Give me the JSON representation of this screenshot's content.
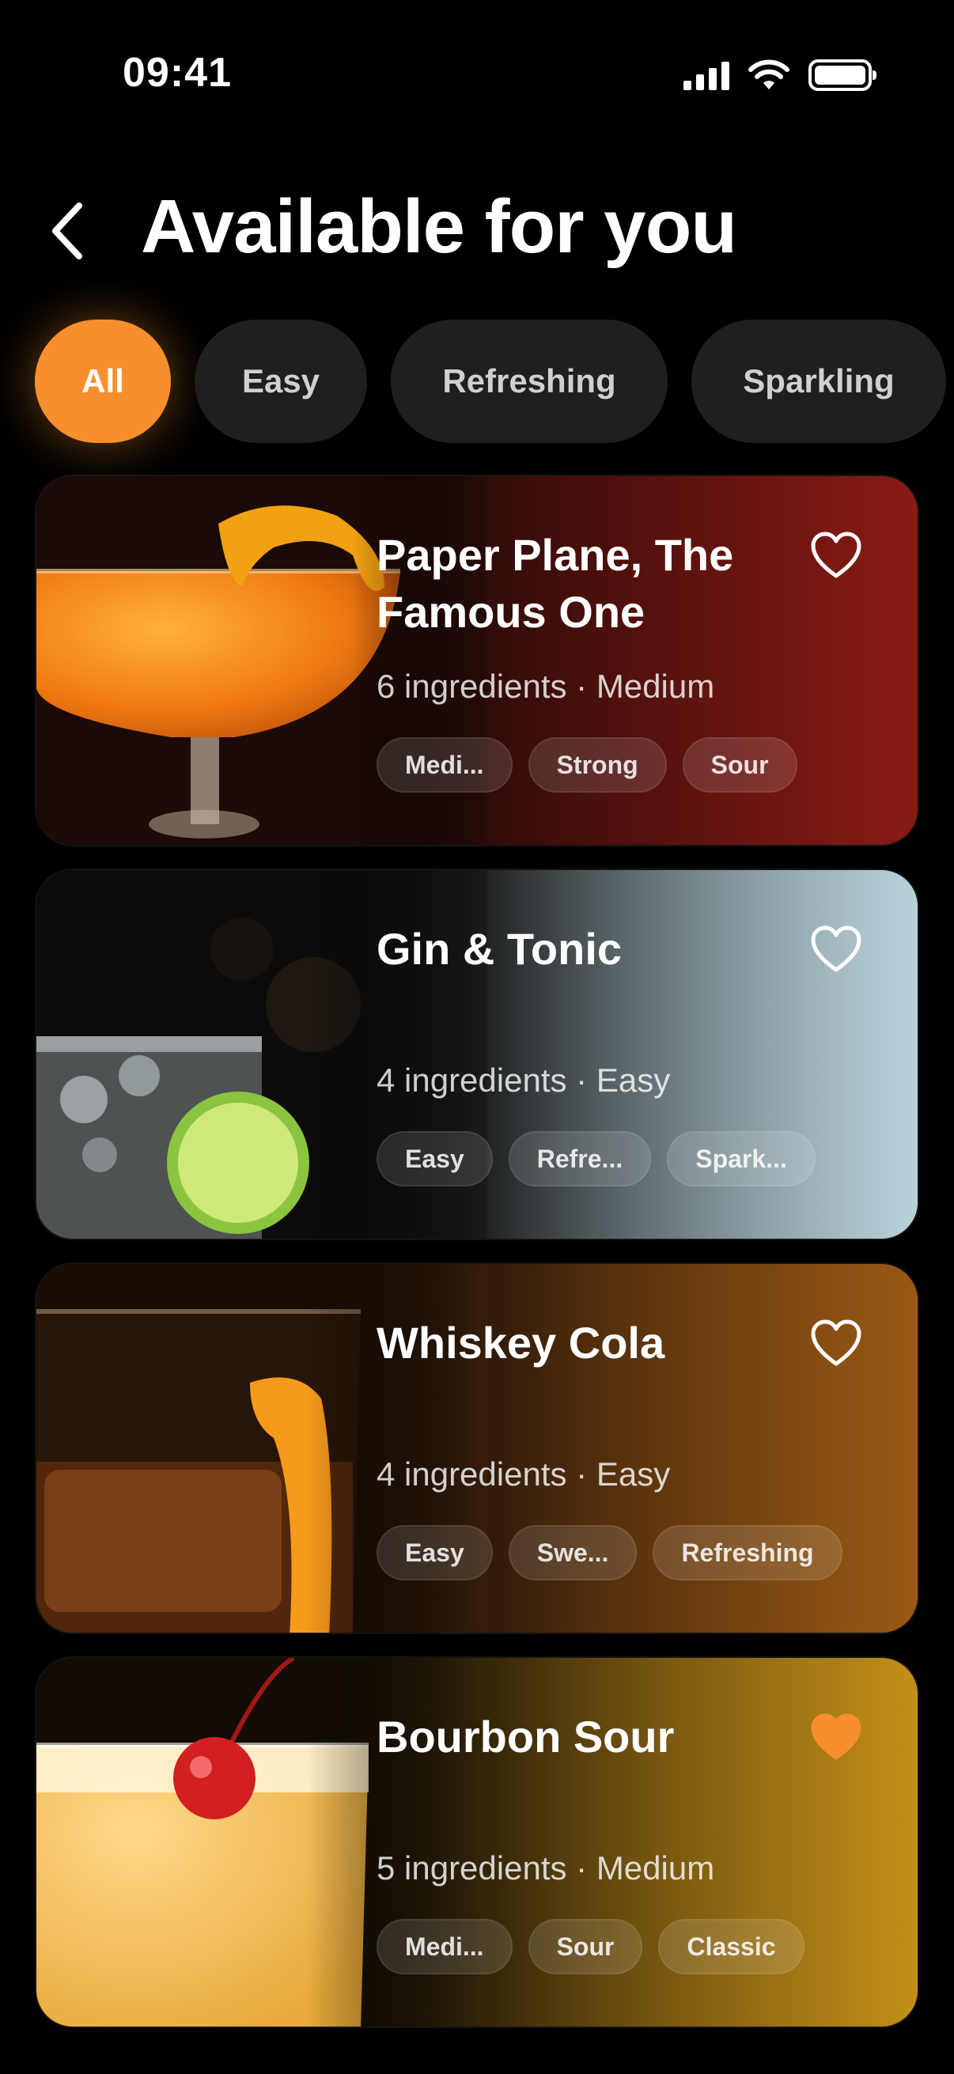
{
  "status_bar": {
    "time": "09:41"
  },
  "header": {
    "title": "Available for you"
  },
  "filters": [
    {
      "label": "All",
      "active": true
    },
    {
      "label": "Easy",
      "active": false
    },
    {
      "label": "Refreshing",
      "active": false
    },
    {
      "label": "Sparkling",
      "active": false
    }
  ],
  "cocktails": [
    {
      "name": "Paper Plane, The Famous One",
      "meta": "6 ingredients · Medium",
      "tags": [
        "Medi...",
        "Strong",
        "Sour"
      ],
      "favorite": false,
      "accent": "#8a1a14"
    },
    {
      "name": "Gin & Tonic",
      "meta": "4 ingredients · Easy",
      "tags": [
        "Easy",
        "Refre...",
        "Spark..."
      ],
      "favorite": false,
      "accent": "#b9d3db"
    },
    {
      "name": "Whiskey Cola",
      "meta": "4 ingredients · Easy",
      "tags": [
        "Easy",
        "Swe...",
        "Refreshing"
      ],
      "favorite": false,
      "accent": "#9a5a14"
    },
    {
      "name": "Bourbon Sour",
      "meta": "5 ingredients · Medium",
      "tags": [
        "Medi...",
        "Sour",
        "Classic"
      ],
      "favorite": true,
      "accent": "#c49018"
    }
  ],
  "colors": {
    "accent": "#f7902c",
    "chip_bg": "#1f1f1f"
  },
  "icons": {
    "back": "chevron-left-icon",
    "favorite": "heart-icon"
  }
}
